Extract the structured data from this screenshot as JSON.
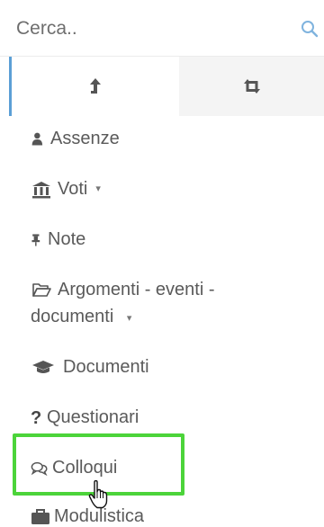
{
  "search": {
    "placeholder": "Cerca.."
  },
  "tabs": [
    {
      "icon": "level-up-icon",
      "active": true
    },
    {
      "icon": "retweet-icon",
      "active": false
    }
  ],
  "menu": {
    "items": [
      {
        "label": "Assenze",
        "icon": "user-icon"
      },
      {
        "label": "Voti",
        "icon": "bank-icon",
        "has_submenu": true
      },
      {
        "label": "Note",
        "icon": "thumbtack-icon"
      },
      {
        "label_line1": "Argomenti - eventi -",
        "label_line2": "documenti",
        "icon": "folder-open-icon",
        "has_submenu": true
      },
      {
        "label": "Documenti",
        "icon": "graduation-cap-icon"
      },
      {
        "label": "Questionari",
        "icon": "question-icon"
      },
      {
        "label": "Colloqui",
        "icon": "comments-icon",
        "highlighted": true
      },
      {
        "label": "Modulistica",
        "icon": "briefcase-icon"
      }
    ],
    "submenu_glyph": "▾"
  },
  "colors": {
    "highlight": "#4cd43a",
    "accent": "#5b9fd6",
    "text": "#5a5a5a"
  }
}
